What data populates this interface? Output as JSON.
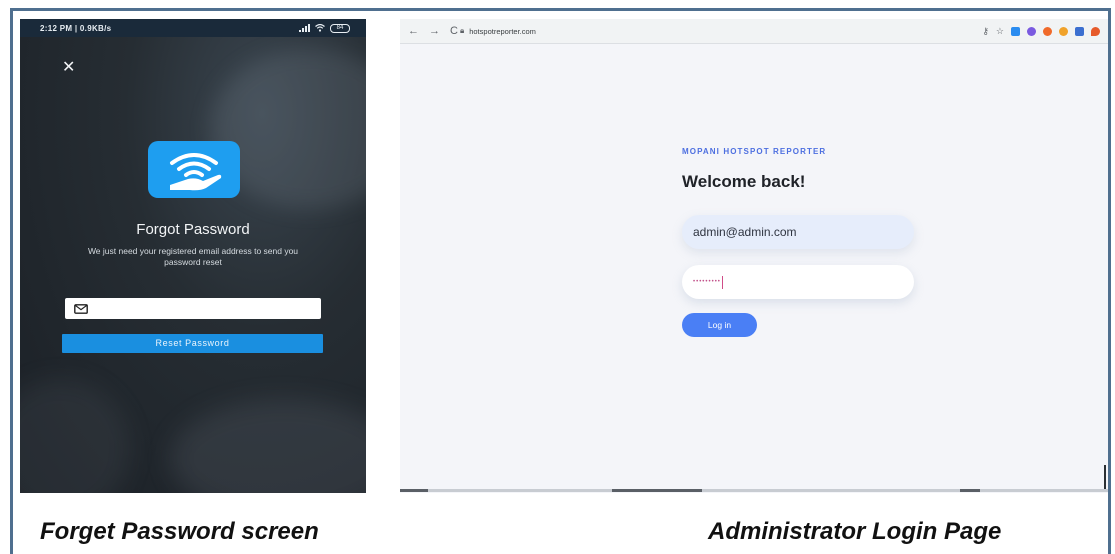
{
  "phone": {
    "status_time": "2:12 PM | 0.9KB/s",
    "battery": "84",
    "title": "Forgot Password",
    "subtitle": "We just need your registered email address to send you password reset",
    "email_placeholder": "",
    "reset_button": "Reset Password",
    "logo_color": "#1e9ef0",
    "button_color": "#1a8fe0"
  },
  "browser": {
    "url": "hotspotreporter.com",
    "brand": "MOPANI HOTSPOT REPORTER",
    "welcome": "Welcome back!",
    "email_value": "admin@admin.com",
    "password_masked": "•••••••••",
    "login_button": "Log in",
    "accent_color": "#4a7ff5"
  },
  "captions": {
    "left": "Forget Password screen",
    "right": "Administrator Login Page"
  }
}
